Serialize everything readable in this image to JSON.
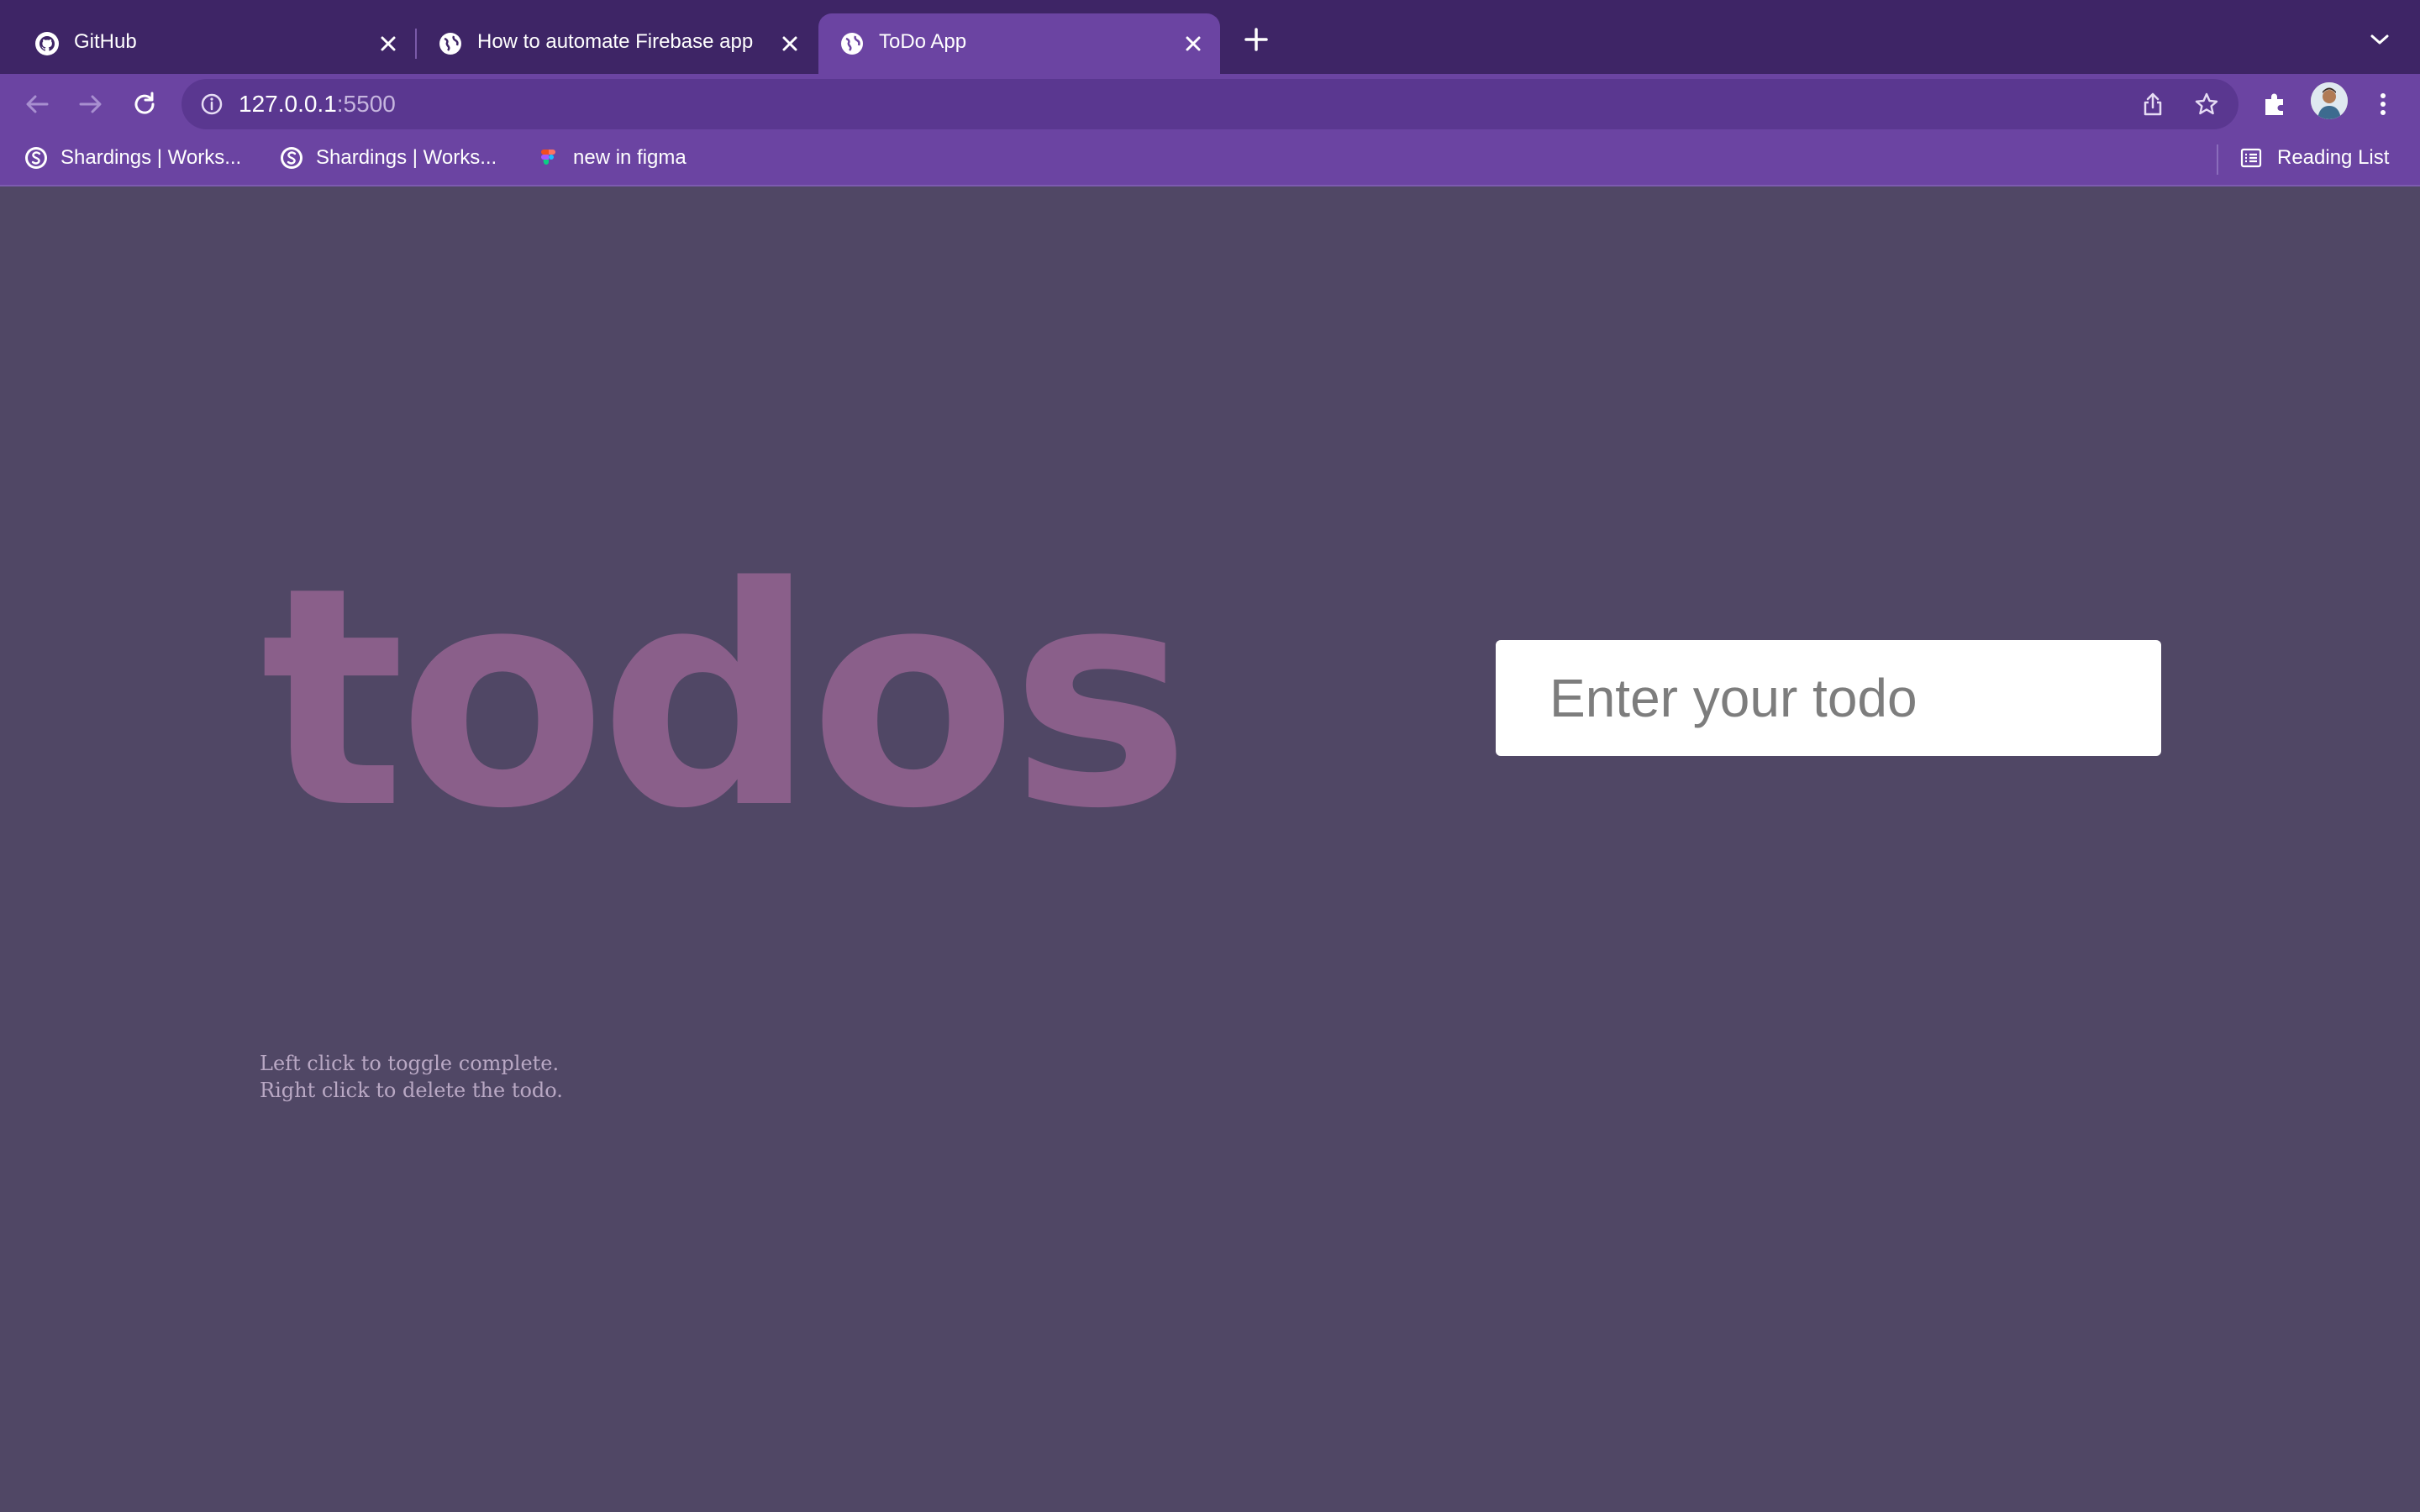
{
  "browser": {
    "tabs": [
      {
        "title": "GitHub",
        "icon": "github-icon",
        "active": false
      },
      {
        "title": "How to automate Firebase app",
        "icon": "globe-icon",
        "active": false
      },
      {
        "title": "ToDo App",
        "icon": "globe-icon",
        "active": true
      }
    ],
    "address": {
      "host": "127.0.0.1",
      "port": ":5500"
    },
    "bookmarks": [
      {
        "label": "Shardings | Works...",
        "icon": "shardings-icon"
      },
      {
        "label": "Shardings | Works...",
        "icon": "shardings-icon"
      },
      {
        "label": "new in figma",
        "icon": "figma-icon"
      }
    ],
    "reading_list_label": "Reading List"
  },
  "app": {
    "logo": "todos",
    "input_placeholder": "Enter your todo",
    "hint_line1": "Left click to toggle complete.",
    "hint_line2": "Right click to delete the todo."
  },
  "colors": {
    "page_bg": "#504765",
    "tabstrip_bg": "#3e2566",
    "toolbar_bg": "#6b44a2",
    "logo": "#8a5f8a",
    "hint": "#b9a8c4"
  }
}
